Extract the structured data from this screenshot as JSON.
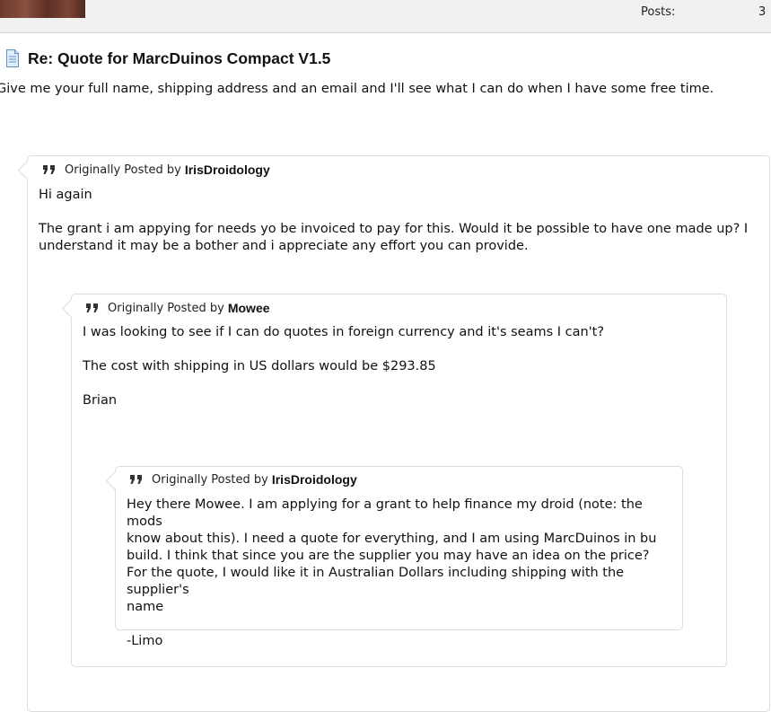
{
  "header": {
    "posts_label": "Posts:",
    "posts_value": "3"
  },
  "post": {
    "title": "Re: Quote for MarcDuinos Compact V1.5",
    "body": "Give me your full name, shipping address and an email and I'll see what I can do when I have some free time."
  },
  "quotes": [
    {
      "prefix": "Originally Posted by",
      "author": "IrisDroidology",
      "lines": [
        "Hi again",
        "",
        "The grant i am appying for needs yo be invoiced to pay for this. Would it be possible to have one made up? I",
        "understand it may be a bother and i appreciate any effort you can provide."
      ]
    },
    {
      "prefix": "Originally Posted by",
      "author": "Mowee",
      "lines": [
        "I was looking to see if I can do quotes in foreign currency and it's seams I can't?",
        "",
        "The cost with shipping in US dollars would be $293.85",
        "",
        "Brian"
      ]
    },
    {
      "prefix": "Originally Posted by",
      "author": "IrisDroidology",
      "lines": [
        "Hey there Mowee. I am applying for a grant to help finance my droid (note: the mods",
        "know about this). I need a quote for everything, and I am using MarcDuinos in bu",
        "build. I think that since you are the supplier you may have an idea on the price?",
        "For the quote, I would like it in Australian Dollars including shipping with the supplier's",
        "name",
        "",
        "-Limo"
      ]
    }
  ],
  "icons": {
    "post_icon": "document-icon",
    "quote_icon": "quote-icon"
  }
}
